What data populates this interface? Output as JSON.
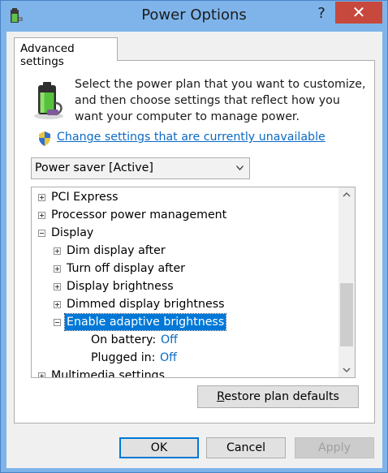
{
  "window": {
    "title": "Power Options",
    "help_label": "?",
    "close_label": "✕"
  },
  "tab": {
    "label": "Advanced settings"
  },
  "intro_text": "Select the power plan that you want to customize, and then choose settings that reflect how you want your computer to manage power.",
  "change_link": "Change settings that are currently unavailable",
  "plan_select": {
    "value": "Power saver [Active]"
  },
  "tree": [
    {
      "label": "PCI Express",
      "level": 0,
      "expander": "plus"
    },
    {
      "label": "Processor power management",
      "level": 0,
      "expander": "plus"
    },
    {
      "label": "Display",
      "level": 0,
      "expander": "minus"
    },
    {
      "label": "Dim display after",
      "level": 1,
      "expander": "plus"
    },
    {
      "label": "Turn off display after",
      "level": 1,
      "expander": "plus"
    },
    {
      "label": "Display brightness",
      "level": 1,
      "expander": "plus"
    },
    {
      "label": "Dimmed display brightness",
      "level": 1,
      "expander": "plus"
    },
    {
      "label": "Enable adaptive brightness",
      "level": 1,
      "expander": "minus",
      "selected": true
    },
    {
      "label": "On battery:",
      "level": 2,
      "value": "Off"
    },
    {
      "label": "Plugged in:",
      "level": 2,
      "value": "Off"
    },
    {
      "label": "Multimedia settings",
      "level": 0,
      "expander": "plus"
    }
  ],
  "buttons": {
    "restore_prefix": "R",
    "restore_rest": "estore plan defaults",
    "ok": "OK",
    "cancel": "Cancel",
    "apply": "Apply"
  },
  "icons": {
    "app": "power-options-icon",
    "battery": "battery-plug-icon",
    "shield": "uac-shield-icon"
  }
}
